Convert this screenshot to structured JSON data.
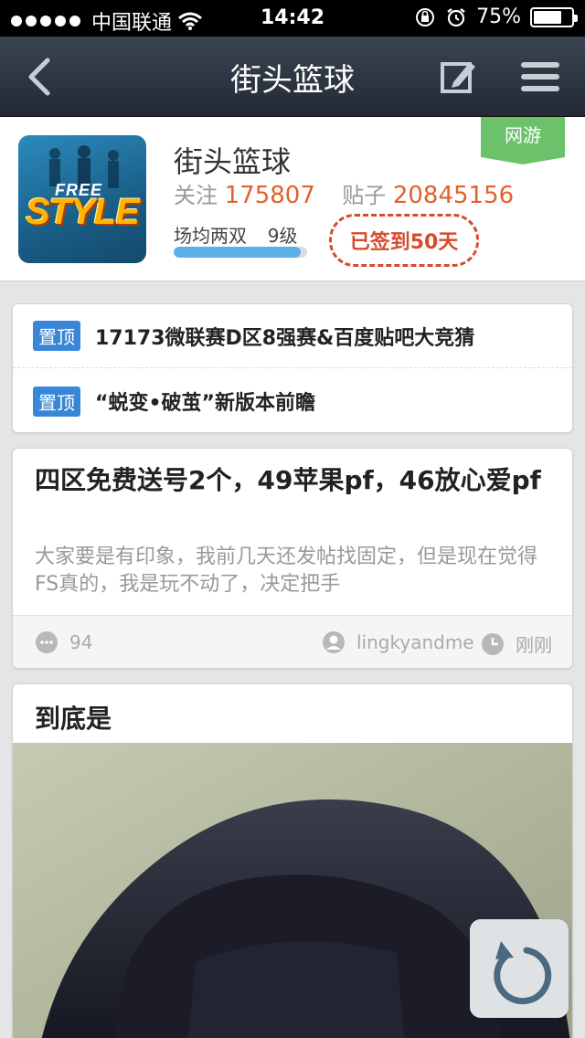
{
  "status_bar": {
    "carrier": "中国联通",
    "time": "14:42",
    "battery": "75%",
    "battery_level": 0.75
  },
  "nav": {
    "title": "街头篮球",
    "back_icon": "chevron-left-icon",
    "edit_icon": "compose-icon",
    "menu_icon": "hamburger-menu-icon"
  },
  "forum": {
    "name": "街头篮球",
    "tag": "网游",
    "follow_label": "关注",
    "follow_count": "175807",
    "posts_label": "贴子",
    "posts_count": "20845156",
    "user_title": "场均两双",
    "user_level": "9级",
    "level_progress": 0.95,
    "signed_text": "已签到50天",
    "logo_text_top": "FREE",
    "logo_text_main": "STYLE"
  },
  "pinned": [
    {
      "tag": "置顶",
      "text": "17173微联赛D区8强赛&百度贴吧大竞猜"
    },
    {
      "tag": "置顶",
      "text": "“蜕变•破茧”新版本前瞻"
    }
  ],
  "posts": [
    {
      "title": "四区免费送号2个，49苹果pf，46放心爱pf",
      "excerpt": "大家要是有印象，我前几天还发帖找固定，但是现在觉得FS真的，我是玩不动了，决定把手",
      "comments": "94",
      "author": "lingkyandme",
      "time": "刚刚"
    },
    {
      "title": "到底是"
    }
  ],
  "colors": {
    "accent_orange": "#e3602d",
    "pin_blue": "#3a86d6",
    "tag_green": "#6cc26b",
    "signed_red": "#d64b2d"
  }
}
